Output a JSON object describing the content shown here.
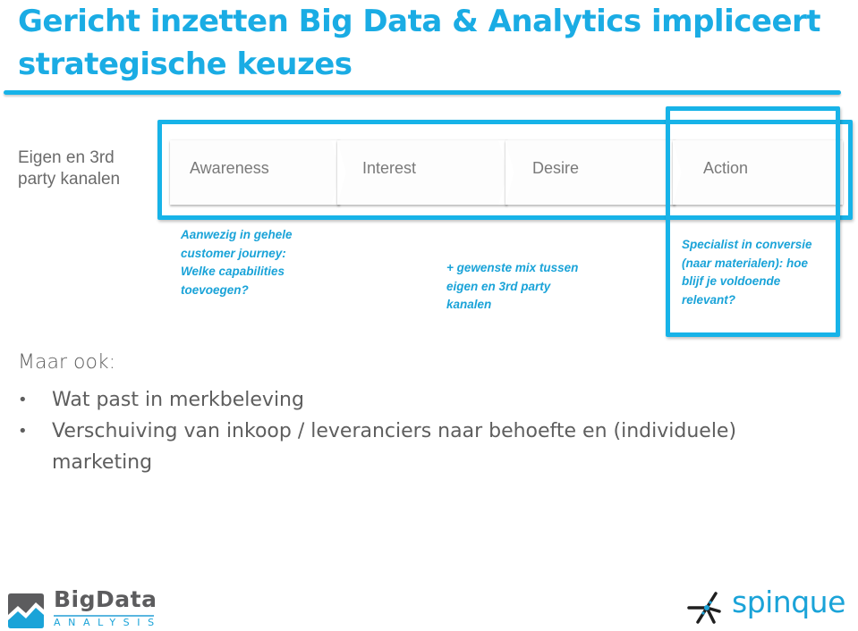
{
  "slide": {
    "title": "Gericht inzetten Big Data & Analytics impliceert strategische keuzes",
    "accent_color": "#17b3e8"
  },
  "funnel": {
    "row_label": "Eigen en 3rd party kanalen",
    "stages": [
      {
        "label": "Awareness"
      },
      {
        "label": "Interest"
      },
      {
        "label": "Desire"
      },
      {
        "label": "Action"
      }
    ]
  },
  "notes": {
    "awareness": "Aanwezig in gehele customer journey: Welke capabilities toevoegen?",
    "interest_desire": "+ gewenste mix tussen eigen en 3rd party kanalen",
    "action": "Specialist in conversie (naar materialen): hoe blijf je voldoende relevant?"
  },
  "body": {
    "intro": "Maar ook:",
    "bullet_symbol": "•",
    "bullets": [
      "Wat past in merkbeleving",
      "Verschuiving van inkoop / leveranciers naar behoefte en (individuele) marketing"
    ]
  },
  "logos": {
    "left": {
      "word": "BigData",
      "sub": "ANALYSIS",
      "icon": "chart-mountain-icon"
    },
    "right": {
      "word": "spinque",
      "icon": "star-network-icon"
    }
  }
}
